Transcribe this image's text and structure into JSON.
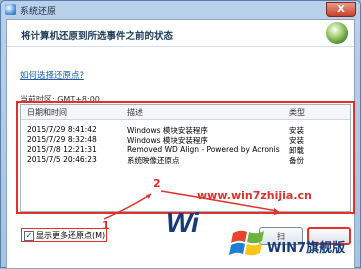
{
  "window": {
    "title": "系统还原",
    "close_label": "X"
  },
  "header": {
    "heading": "将计算机还原到所选事件之前的状态"
  },
  "link": "如何选择还原点?",
  "timezone": "当前时区: GMT+8:00",
  "table": {
    "columns": [
      "日期和时间",
      "描述",
      "类型"
    ],
    "rows": [
      [
        "2015/7/29 8:41:42",
        "Windows 模块安装程序",
        "安装"
      ],
      [
        "2015/7/29 8:32:48",
        "Windows 模块安装程序",
        "安装"
      ],
      [
        "2015/7/8 12:21:31",
        "Removed WD Align - Powered by Acronis",
        "卸载"
      ],
      [
        "2015/7/5 20:46:23",
        "系统映像还原点",
        "备份"
      ]
    ]
  },
  "checkbox": {
    "label": "显示更多还原点(M)",
    "checked": true,
    "mark": "✓"
  },
  "buttons": {
    "scan": "扫"
  },
  "annotations": {
    "one": "1",
    "two": "2"
  },
  "watermark": {
    "url": "www.win7zhijia.cn",
    "logo": "Wi",
    "brand": "WIN7旗舰版"
  },
  "colors": {
    "accent_red": "#e0312a",
    "brand_blue": "#163a7a"
  }
}
